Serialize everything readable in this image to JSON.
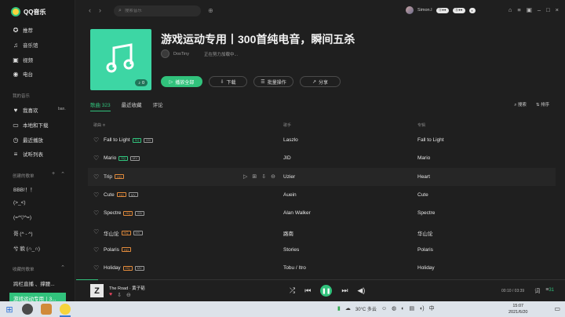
{
  "app": {
    "name": "QQ音乐"
  },
  "sidebar": {
    "nav": [
      {
        "label": "推荐",
        "icon": "compass-icon"
      },
      {
        "label": "音乐馆",
        "icon": "music-note-icon"
      },
      {
        "label": "视频",
        "icon": "video-icon"
      },
      {
        "label": "电台",
        "icon": "radio-icon"
      }
    ],
    "my_music_title": "我的音乐",
    "my_music": [
      {
        "label": "我喜欢",
        "icon": "heart-icon"
      },
      {
        "label": "本地和下载",
        "icon": "computer-icon"
      },
      {
        "label": "最近播放",
        "icon": "clock-icon"
      },
      {
        "label": "试听列表",
        "icon": "list-icon"
      }
    ],
    "ban_tag": "ban.",
    "created_title": "创建的歌单",
    "created_playlists": [
      "BBB!！！",
      "(>_<)",
      "(=^▽^=)",
      "哥 (^ - ^)",
      "兮 貌 (∩_∩)"
    ],
    "favorites_title": "收藏的歌单",
    "favorite_playlists": [
      "跨栏直播 、撑腰...",
      "游戏运动专用丨3..."
    ]
  },
  "topbar": {
    "search_placeholder": "搜索音乐",
    "username": "Simon.I",
    "badges": [
      "Ⓢ●●",
      "Ⓢ●●",
      "◐"
    ]
  },
  "playlist": {
    "title": "游戏运动专用丨300首纯电音，瞬间五杀",
    "creator": "DosTiny",
    "loading": "正在努力加载中...",
    "listen_count": "0",
    "buttons": {
      "play_all": "播放全部",
      "download": "下载",
      "batch": "批量操作",
      "share": "分享"
    }
  },
  "tabs": {
    "songs": "歌曲 323",
    "recent": "最近收藏",
    "comments": "评论",
    "search": "搜索",
    "sort": "排序"
  },
  "columns": {
    "song": "歌曲 ≑",
    "artist": "歌手",
    "album": "专辑"
  },
  "songs": [
    {
      "title": "Fall to Light",
      "tags": [
        "SQ",
        "MV"
      ],
      "artist": "Laszlo",
      "album": "Fall to Light"
    },
    {
      "title": "Mario",
      "tags": [
        "SQ",
        "MV"
      ],
      "artist": "JID",
      "album": "Mario"
    },
    {
      "title": "Trip",
      "tags": [
        "HQ"
      ],
      "artist": "Uzier",
      "album": "Heart"
    },
    {
      "title": "Cute",
      "tags": [
        "HQ",
        "MV"
      ],
      "artist": "Auein",
      "album": "Cute"
    },
    {
      "title": "Spectre",
      "tags": [
        "HQ",
        "MV"
      ],
      "artist": "Alan Walker",
      "album": "Spectre"
    },
    {
      "title": "华山论",
      "tags": [
        "HQ",
        "MV"
      ],
      "artist": "路南",
      "album": "华山论"
    },
    {
      "title": "Polaris",
      "tags": [
        "HQ"
      ],
      "artist": "Stories",
      "album": "Polaris"
    },
    {
      "title": "Holiday",
      "tags": [
        "HQ",
        "MV"
      ],
      "artist": "Tobu / Itro",
      "album": "Holiday"
    }
  ],
  "player": {
    "song": "The Road",
    "artist": "黄子韬",
    "time": "00:10 / 03:39",
    "playlist_count": "31",
    "progress": 0.045
  },
  "taskbar": {
    "weather": "30°C 多云",
    "time": "15:07",
    "date": "2021/6/20"
  },
  "colors": {
    "accent": "#31c27c",
    "background": "#1f1f1f"
  }
}
